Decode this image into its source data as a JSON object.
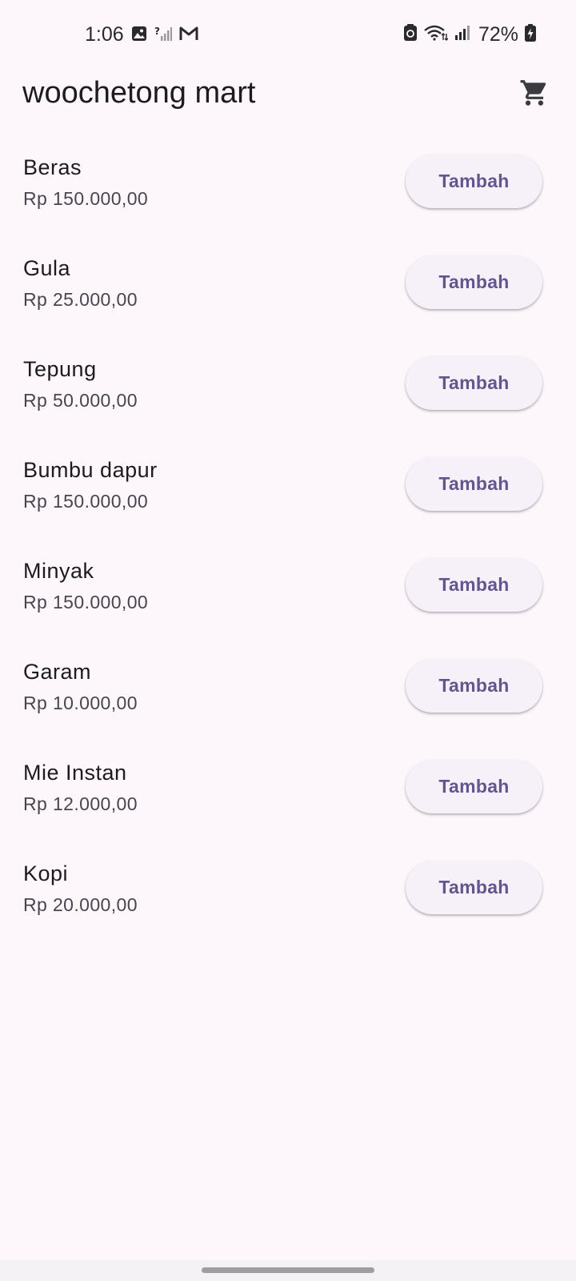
{
  "status_bar": {
    "time": "1:06",
    "battery_percent": "72%"
  },
  "app_bar": {
    "title": "woochetong mart",
    "cart_icon": "shopping-cart-icon"
  },
  "products": [
    {
      "name": "Beras",
      "price": "Rp 150.000,00",
      "button_label": "Tambah"
    },
    {
      "name": "Gula",
      "price": "Rp 25.000,00",
      "button_label": "Tambah"
    },
    {
      "name": "Tepung",
      "price": "Rp 50.000,00",
      "button_label": "Tambah"
    },
    {
      "name": "Bumbu dapur",
      "price": "Rp 150.000,00",
      "button_label": "Tambah"
    },
    {
      "name": "Minyak",
      "price": "Rp 150.000,00",
      "button_label": "Tambah"
    },
    {
      "name": "Garam",
      "price": "Rp 10.000,00",
      "button_label": "Tambah"
    },
    {
      "name": "Mie Instan",
      "price": "Rp 12.000,00",
      "button_label": "Tambah"
    },
    {
      "name": "Kopi",
      "price": "Rp 20.000,00",
      "button_label": "Tambah"
    }
  ],
  "colors": {
    "background": "#fdf7fc",
    "button_background": "#f6f1f9",
    "button_text": "#65558f"
  }
}
